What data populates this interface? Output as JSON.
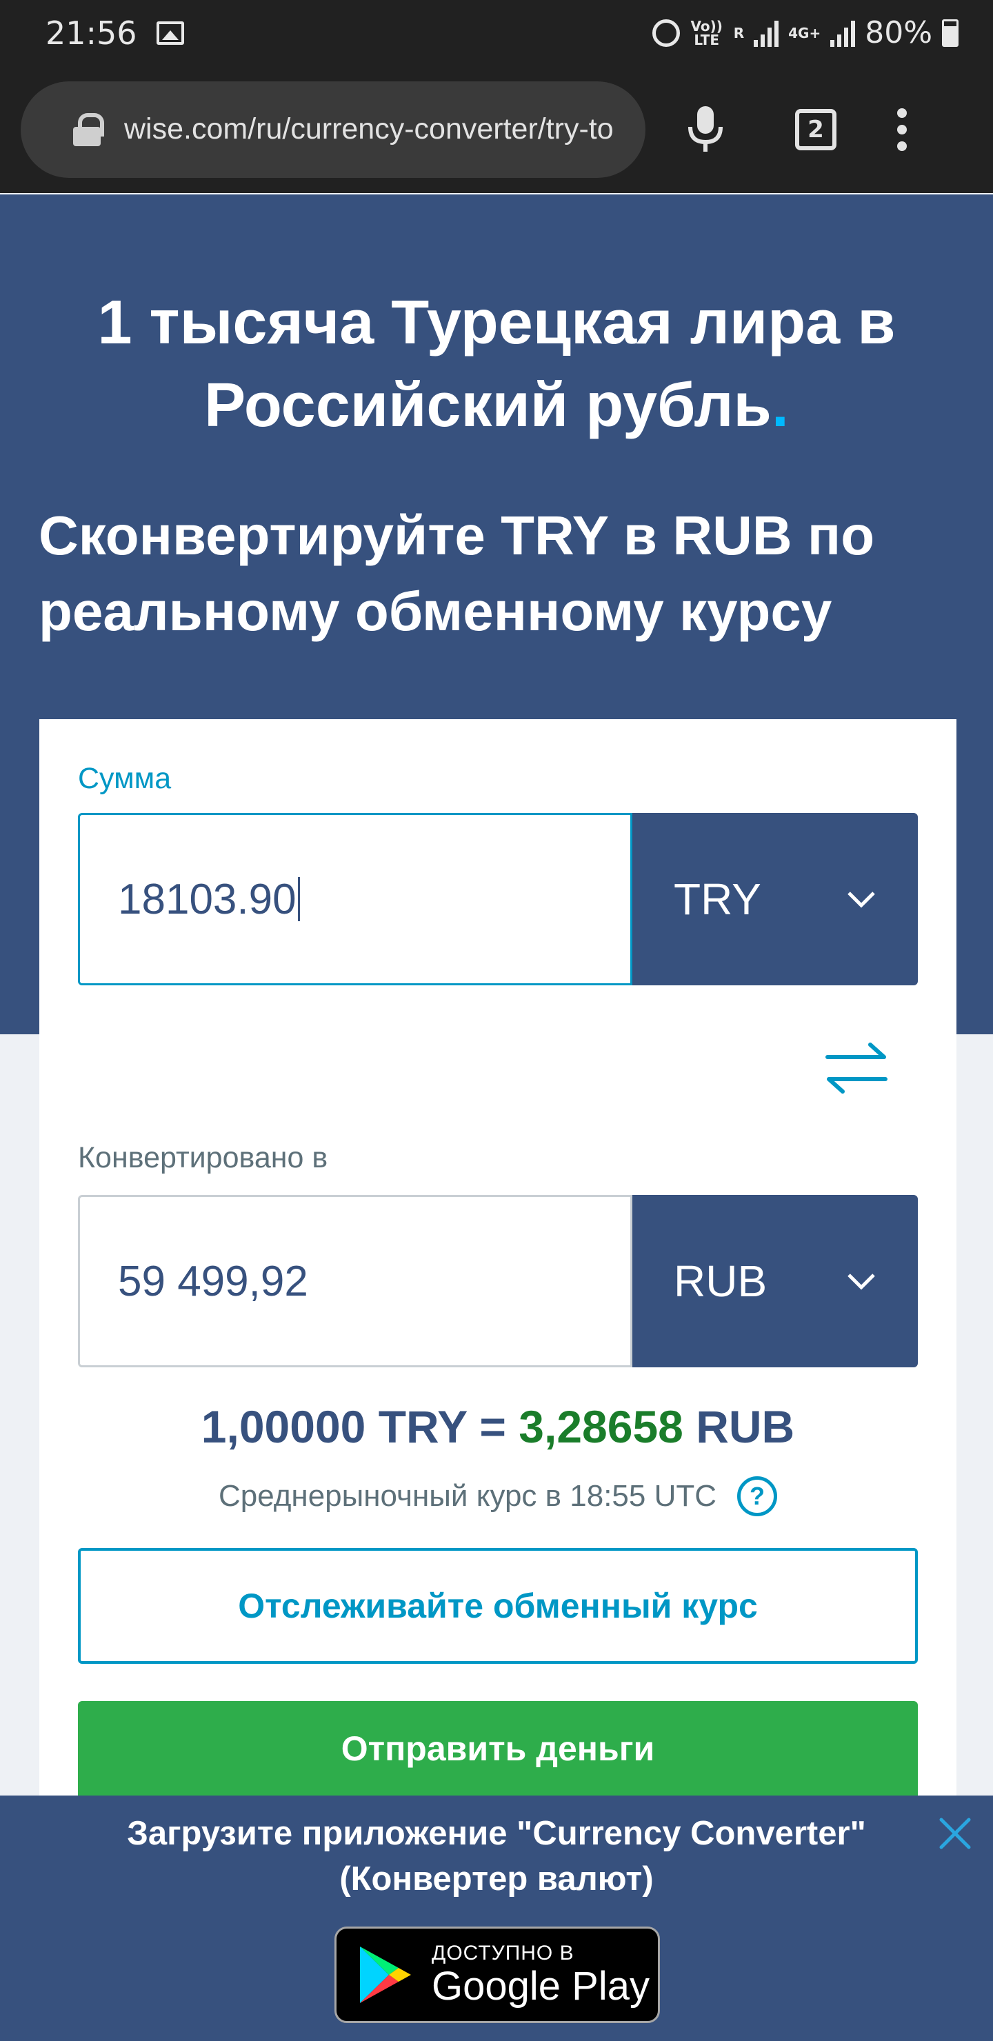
{
  "status_bar": {
    "time": "21:56",
    "net_volte": "Vo)) LTE",
    "net_r": "R",
    "net_4g": "4G+",
    "battery": "80%"
  },
  "browser": {
    "url": "wise.com/ru/currency-converter/try-to",
    "tab_count": "2"
  },
  "hero": {
    "title_main": "1 тысяча Турецкая лира в Российский рубль",
    "title_dot": ".",
    "subtitle": "Сконвертируйте TRY в RUB по реальному обменному курсу"
  },
  "converter": {
    "amount_label": "Сумма",
    "amount_value": "18103.90",
    "from_currency": "TRY",
    "converted_label": "Конвертировано в",
    "converted_value": "59 499,92",
    "to_currency": "RUB",
    "rate_left": "1,00000 TRY = ",
    "rate_value": "3,28658",
    "rate_right": " RUB",
    "rate_note": "Среднерыночный курс в 18:55 UTC",
    "help_symbol": "?",
    "track_button": "Отслеживайте обменный курс",
    "send_button": "Отправить деньги"
  },
  "app_banner": {
    "text_line1": "Загрузите приложение \"Currency Converter\"",
    "text_line2": "(Конвертер валют)",
    "badge_small": "ДОСТУПНО В",
    "badge_large": "Google Play"
  },
  "colors": {
    "brand_navy": "#37517e",
    "accent_blue": "#0097c5",
    "send_green": "#2ead4b",
    "rate_green": "#1a7d2a"
  }
}
